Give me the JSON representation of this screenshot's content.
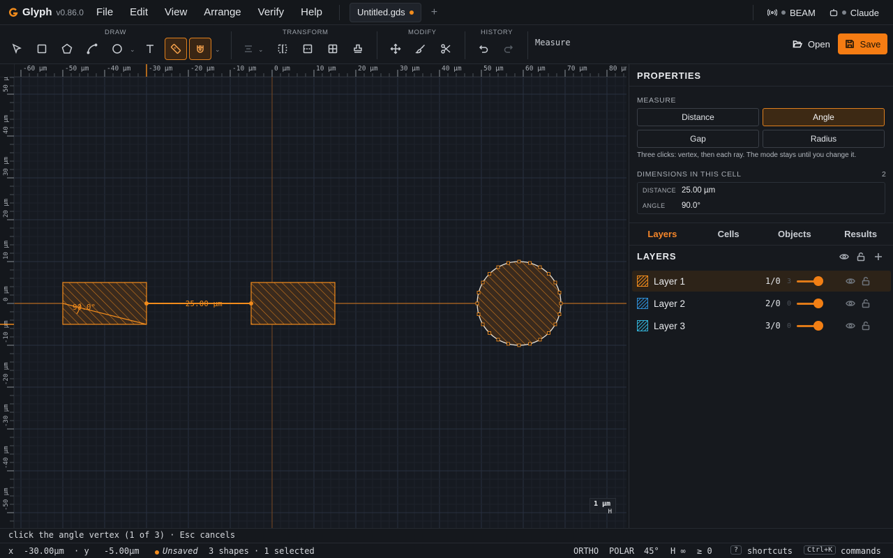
{
  "app": {
    "name": "Glyph",
    "version": "v0.86.0"
  },
  "menus": [
    "File",
    "Edit",
    "View",
    "Arrange",
    "Verify",
    "Help"
  ],
  "document_tab": {
    "title": "Untitled.gds",
    "new_tab_glyph": "+"
  },
  "status_right": {
    "beam_label": "BEAM",
    "claude_label": "Claude"
  },
  "toolbar": {
    "groups": {
      "draw": "DRAW",
      "transform": "TRANSFORM",
      "modify": "MODIFY",
      "history": "HISTORY"
    },
    "mode_label": "Measure",
    "open_label": "Open",
    "save_label": "Save"
  },
  "canvas": {
    "ruler_x_labels": [
      "-60 µm",
      "-50 µm",
      "-40 µm",
      "-30 µm",
      "-20 µm",
      "-10 µm",
      "0 µm",
      "10 µm",
      "20 µm",
      "30 µm",
      "40 µm",
      "50 µm",
      "60 µm",
      "70 µm",
      "80 µm"
    ],
    "ruler_y_labels": [
      "50 µm",
      "40 µm",
      "30 µm",
      "20 µm",
      "10 µm",
      "0 µm",
      "-10 µm",
      "-20 µm",
      "-30 µm",
      "-40 µm",
      "-50 µm"
    ],
    "distance_label": "25.00 µm",
    "angle_label": "90.0°",
    "scale_label": "1 µm",
    "scale_sub": "H",
    "accent": "#f28c1c"
  },
  "panel": {
    "title": "PROPERTIES",
    "measure_heading": "MEASURE",
    "modes": [
      {
        "label": "Distance",
        "active": false
      },
      {
        "label": "Angle",
        "active": true
      },
      {
        "label": "Gap",
        "active": false
      },
      {
        "label": "Radius",
        "active": false
      }
    ],
    "hint": "Three clicks: vertex, then each ray. The mode stays until you change it.",
    "dims_heading": "DIMENSIONS IN THIS CELL",
    "dims_count": "2",
    "dims": [
      {
        "key": "DISTANCE",
        "value": "25.00 µm"
      },
      {
        "key": "ANGLE",
        "value": "90.0°"
      }
    ],
    "tabs": [
      "Layers",
      "Cells",
      "Objects",
      "Results"
    ],
    "active_tab": "Layers",
    "layers_heading": "LAYERS",
    "layers": [
      {
        "name": "Layer 1",
        "num": "1/0",
        "count": "3",
        "color": "#f28c1c",
        "selected": true
      },
      {
        "name": "Layer 2",
        "num": "2/0",
        "count": "0",
        "color": "#2f8fd6",
        "selected": false
      },
      {
        "name": "Layer 3",
        "num": "3/0",
        "count": "0",
        "color": "#33b3d8",
        "selected": false
      }
    ]
  },
  "prompt": "click the angle vertex (1 of 3) · Esc cancels",
  "status": {
    "x_label": "x",
    "x_value": "-30.00µm",
    "y_label": "· y",
    "y_value": "-5.00µm",
    "saved_state": "Unsaved",
    "summary": "3 shapes · 1 selected",
    "ortho": "ORTHO",
    "polar": "POLAR",
    "polar_angle": "45°",
    "h": "H ∞",
    "ge": "≥ 0",
    "shortcuts_key": "?",
    "shortcuts_label": "shortcuts",
    "commands_key": "Ctrl+K",
    "commands_label": "commands"
  }
}
